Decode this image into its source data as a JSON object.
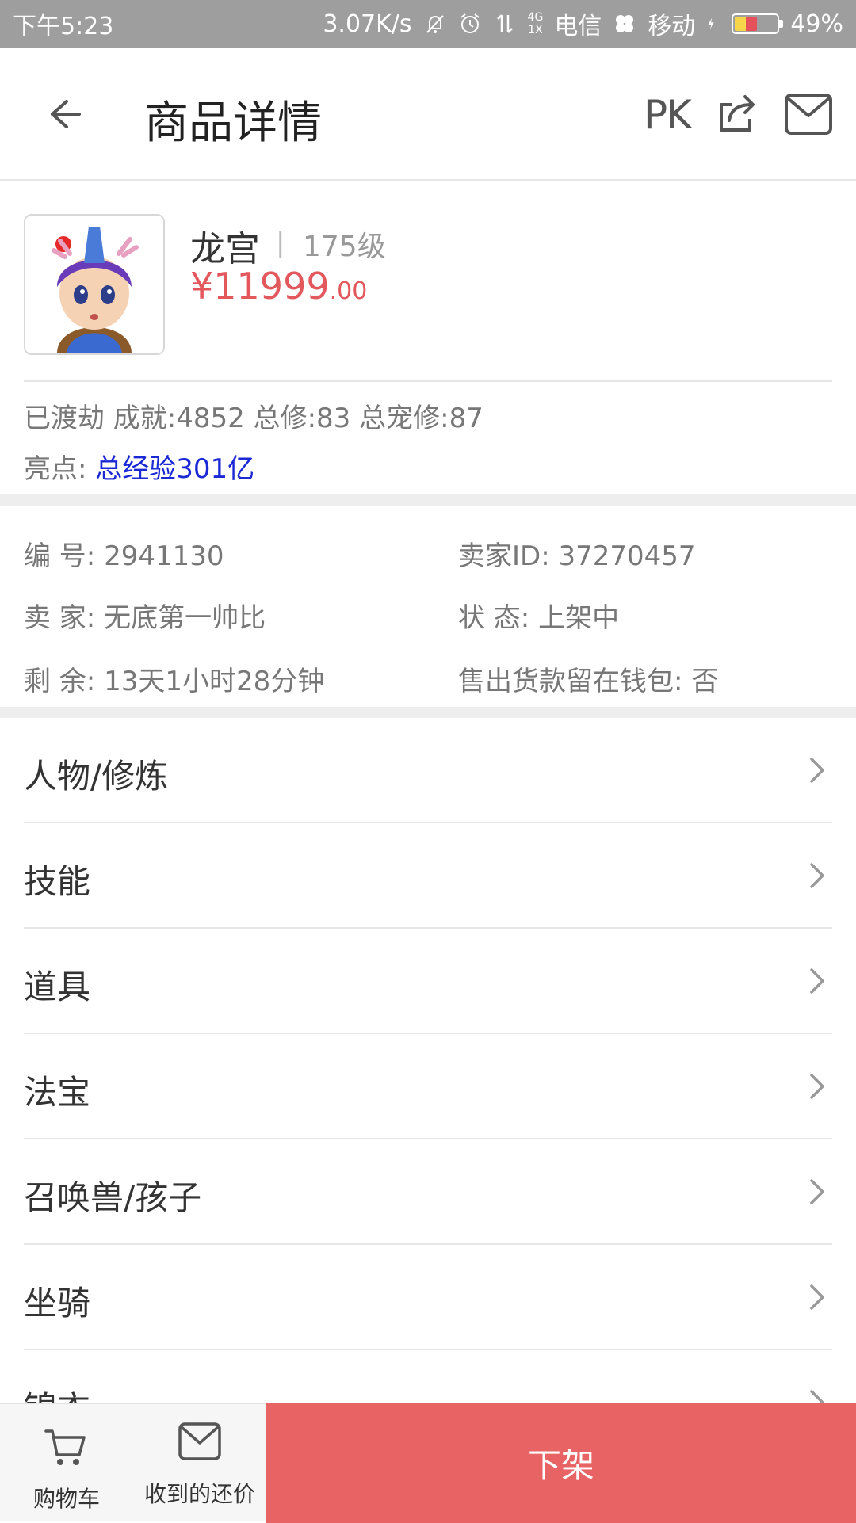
{
  "status_bar": {
    "time": "下午5:23",
    "speed": "3.07K/s",
    "net_4g": "4G",
    "net_1x": "1X",
    "carrier1": "电信",
    "carrier2": "移动",
    "battery": "49%"
  },
  "header": {
    "title": "商品详情",
    "pk_label": "PK"
  },
  "product": {
    "name": "龙宫",
    "separator": "|",
    "level": "175级",
    "price_main": "¥11999",
    "price_decimal": ".00",
    "stats": "已渡劫 成就:4852 总修:83 总宠修:87",
    "highlight_label": "亮点:",
    "highlight_value": "总经验301亿"
  },
  "info": {
    "id": "编  号: 2941130",
    "seller_id": "卖家ID: 37270457",
    "seller": "卖  家: 无底第一帅比",
    "status": "状  态: 上架中",
    "remaining": "剩  余: 13天1小时28分钟",
    "wallet": "售出货款留在钱包: 否"
  },
  "menu": {
    "items": [
      {
        "label": "人物/修炼"
      },
      {
        "label": "技能"
      },
      {
        "label": "道具"
      },
      {
        "label": "法宝"
      },
      {
        "label": "召唤兽/孩子"
      },
      {
        "label": "坐骑"
      },
      {
        "label": "锦衣"
      }
    ]
  },
  "bottom": {
    "cart_label": "购物车",
    "offers_label": "收到的还价",
    "delist_label": "下架"
  },
  "colors": {
    "price": "#e2585d",
    "highlight": "#1a28d6",
    "delist_button": "#e86364",
    "status_bar": "#9e9e9e"
  }
}
